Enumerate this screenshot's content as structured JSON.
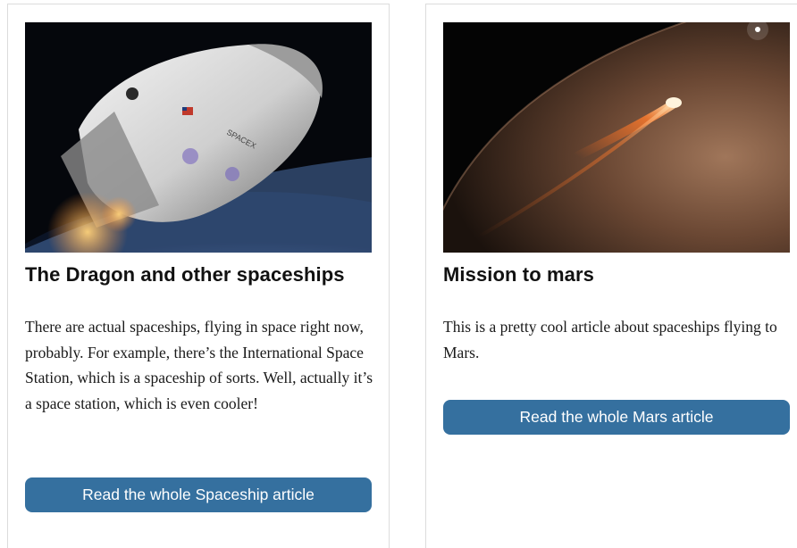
{
  "colors": {
    "button_bg": "#35709f",
    "card_border": "#dcdcdc",
    "title": "#111111",
    "body_text": "#1a1a1a"
  },
  "cards": [
    {
      "image": "dragon-spaceship-orbit-photo",
      "title": "The Dragon and other spaceships",
      "text": "There are actual spaceships, flying in space right now, probably. For example, there’s the International Space Station, which is a spaceship of sorts. Well, actually it’s a space station, which is even cooler!",
      "button_label": "Read the whole Spaceship article"
    },
    {
      "image": "mars-entry-photo",
      "title": "Mission to mars",
      "text": "This is a pretty cool article about spaceships flying to Mars.",
      "button_label": "Read the whole Mars article"
    }
  ]
}
